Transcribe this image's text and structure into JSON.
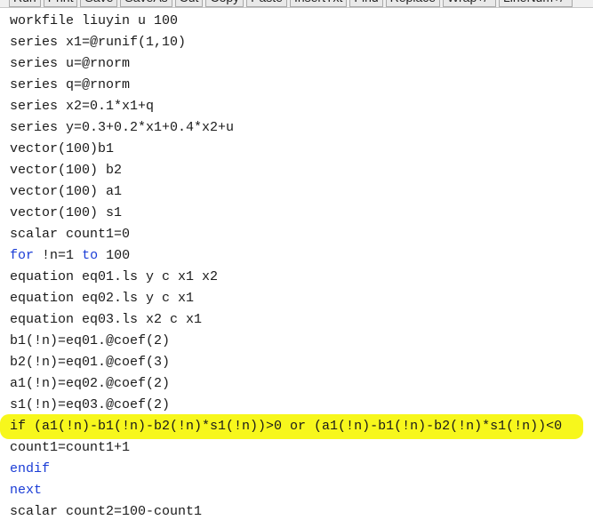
{
  "toolbar": {
    "buttons": [
      "Run",
      "Print",
      "Save",
      "SaveAs",
      "Cut",
      "Copy",
      "Paste",
      "InsertTxt",
      "Find",
      "Replace",
      "Wrap+/-",
      "LineNum+/-"
    ]
  },
  "editor": {
    "lines": [
      "workfile liuyin u 100",
      "series x1=@runif(1,10)",
      "series u=@rnorm",
      "series q=@rnorm",
      "series x2=0.1*x1+q",
      "series y=0.3+0.2*x1+0.4*x2+u",
      "vector(100)b1",
      "vector(100) b2",
      "vector(100) a1",
      "vector(100) s1",
      "scalar count1=0",
      "for !n=1 to 100",
      "equation eq01.ls y c x1 x2",
      "equation eq02.ls y c x1",
      "equation eq03.ls x2 c x1",
      "b1(!n)=eq01.@coef(2)",
      "b2(!n)=eq01.@coef(3)",
      "a1(!n)=eq02.@coef(2)",
      "s1(!n)=eq03.@coef(2)",
      "if (a1(!n)-b1(!n)-b2(!n)*s1(!n))>0 or (a1(!n)-b1(!n)-b2(!n)*s1(!n))<0",
      "count1=count1+1",
      "endif",
      "next",
      "scalar count2=100-count1"
    ],
    "keywords": [
      "for",
      "to",
      "endif",
      "next"
    ],
    "highlighted_line": 19,
    "colors": {
      "text": "#1a1a1a",
      "keyword": "#1a3cd6",
      "highlight": "#f7f71c",
      "background": "#ffffff"
    }
  }
}
